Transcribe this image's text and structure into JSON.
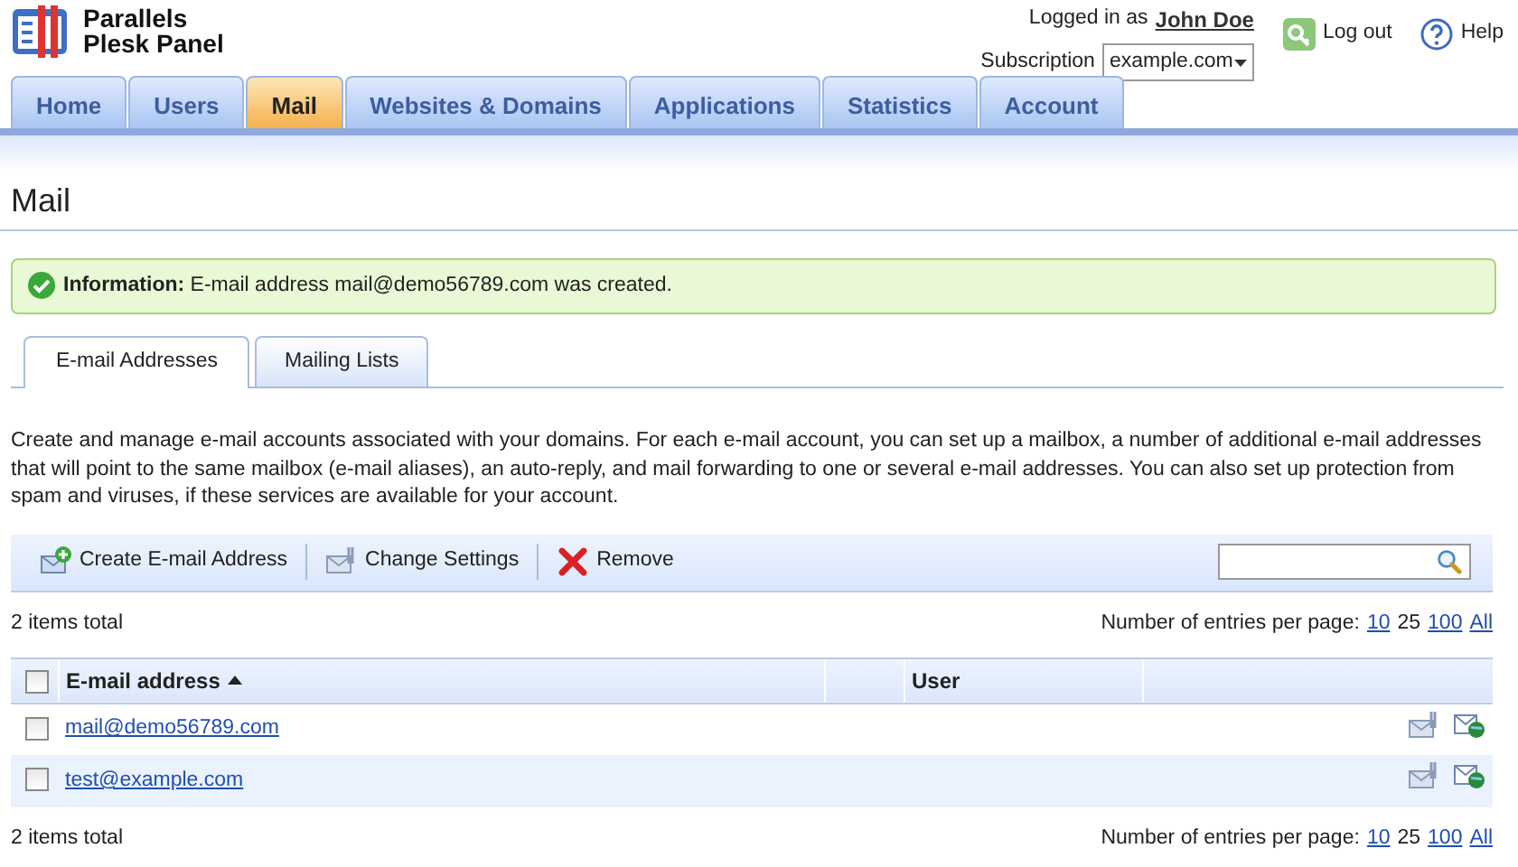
{
  "header": {
    "logo_lines": [
      "Parallels",
      "Plesk Panel"
    ],
    "logged_in_label": "Logged in as",
    "user_name": "John Doe",
    "subscription_label": "Subscription",
    "subscription_value": "example.com",
    "logout": "Log out",
    "help": "Help"
  },
  "main_tabs": [
    {
      "label": "Home",
      "selected": false
    },
    {
      "label": "Users",
      "selected": false
    },
    {
      "label": "Mail",
      "selected": true
    },
    {
      "label": "Websites & Domains",
      "selected": false
    },
    {
      "label": "Applications",
      "selected": false
    },
    {
      "label": "Statistics",
      "selected": false
    },
    {
      "label": "Account",
      "selected": false
    }
  ],
  "page_title": "Mail",
  "message": {
    "label": "Information:",
    "text": "E-mail address mail@demo56789.com was created."
  },
  "sub_tabs": [
    {
      "label": "E-mail Addresses",
      "selected": true
    },
    {
      "label": "Mailing Lists",
      "selected": false
    }
  ],
  "description": "Create and manage e-mail accounts associated with your domains. For each e-mail account, you can set up a mailbox, a number of additional e-mail addresses that will point to the same mailbox (e-mail aliases), an auto-reply, and mail forwarding to one or several e-mail addresses. You can also set up protection from spam and viruses, if these services are available for your account.",
  "toolbar": [
    {
      "kind": "create",
      "label": "Create E-mail Address"
    },
    {
      "kind": "settings",
      "label": "Change Settings"
    },
    {
      "kind": "remove",
      "label": "Remove"
    }
  ],
  "total_top": "2 items total",
  "pager_top": {
    "label": "Number of entries per page:",
    "options": [
      {
        "label": "10",
        "selected": false
      },
      {
        "label": "25",
        "selected": true
      },
      {
        "label": "100",
        "selected": false
      },
      {
        "label": "All",
        "selected": false
      }
    ]
  },
  "table": {
    "columns": [
      {
        "label": "E-mail address",
        "sorted": true
      },
      {
        "label": "User",
        "sorted": false
      }
    ],
    "select_all_checked": false,
    "rows": [
      {
        "email": "mail@demo56789.com",
        "checked": false
      },
      {
        "email": "test@example.com",
        "checked": false
      }
    ]
  },
  "total_bottom": "2 items total",
  "pager_bottom": {
    "label": "Number of entries per page:",
    "options": [
      {
        "label": "10",
        "selected": false
      },
      {
        "label": "25",
        "selected": true
      },
      {
        "label": "100",
        "selected": false
      },
      {
        "label": "All",
        "selected": false
      }
    ]
  }
}
